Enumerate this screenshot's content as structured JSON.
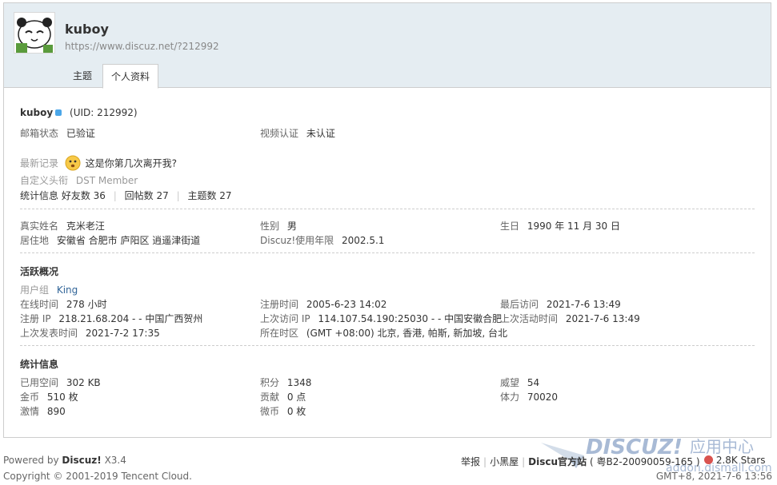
{
  "profile": {
    "username": "kuboy",
    "url": "https://www.discuz.net/?212992",
    "uid_text": "(UID: 212992)"
  },
  "tabs": {
    "threads": "主题",
    "profile": "个人资料"
  },
  "basic": {
    "email_status_label": "邮箱状态",
    "email_status_value": "已验证",
    "video_label": "视频认证",
    "video_value": "未认证",
    "recent_label": "最新记录",
    "recent_value": "这是你第几次离开我?",
    "title_label": "自定义头衔",
    "title_value": "DST Member",
    "stats_label": "统计信息",
    "friends": "好友数 36",
    "replies": "回帖数 27",
    "threads": "主题数 27"
  },
  "personal": {
    "realname_label": "真实姓名",
    "realname_value": "克米老汪",
    "gender_label": "性别",
    "gender_value": "男",
    "birthday_label": "生日",
    "birthday_value": "1990 年 11 月 30 日",
    "residence_label": "居住地",
    "residence_value": "安徽省 合肥市 庐阳区 逍遥津街道",
    "years_label": "Discuz!使用年限",
    "years_value": "2002.5.1"
  },
  "activity": {
    "heading": "活跃概况",
    "group_label": "用户组",
    "group_value": "King",
    "online_label": "在线时间",
    "online_value": "278 小时",
    "regtime_label": "注册时间",
    "regtime_value": "2005-6-23 14:02",
    "lastvisit_label": "最后访问",
    "lastvisit_value": "2021-7-6 13:49",
    "regip_label": "注册 IP",
    "regip_value": "218.21.68.204 - - 中国广西贺州",
    "lastip_label": "上次访问 IP",
    "lastip_value": "114.107.54.190:25030 - - 中国安徽合肥",
    "lastactive_label": "上次活动时间",
    "lastactive_value": "2021-7-6 13:49",
    "lastpost_label": "上次发表时间",
    "lastpost_value": "2021-7-2 17:35",
    "timezone_label": "所在时区",
    "timezone_value": "(GMT +08:00) 北京, 香港, 帕斯, 新加坡, 台北"
  },
  "statistics": {
    "heading": "统计信息",
    "space_label": "已用空间",
    "space_value": "302 KB",
    "points_label": "积分",
    "points_value": "1348",
    "prestige_label": "威望",
    "prestige_value": "54",
    "money_label": "金币",
    "money_value": "510 枚",
    "contrib_label": "贡献",
    "contrib_value": "0 点",
    "stamina_label": "体力",
    "stamina_value": "70020",
    "passion_label": "激情",
    "passion_value": "890",
    "microcoin_label": "微币",
    "microcoin_value": "0 枚"
  },
  "footer": {
    "powered_prefix": "Powered by",
    "powered_brand": "Discuz!",
    "powered_version": "X3.4",
    "copyright": "Copyright © 2001-2019 Tencent Cloud.",
    "report": "举报",
    "blackroom": "小黑屋",
    "official_prefix": "Discu",
    "official": "官方站",
    "icp": "( 粤B2-20090059-165 )",
    "stars": "2.8K Stars",
    "gmt": "GMT+8, 2021-7-6 13:56",
    "watermark_brand": "DISCUZ!",
    "watermark_app": "应用中心",
    "watermark_url": "addon.dismall.com"
  }
}
